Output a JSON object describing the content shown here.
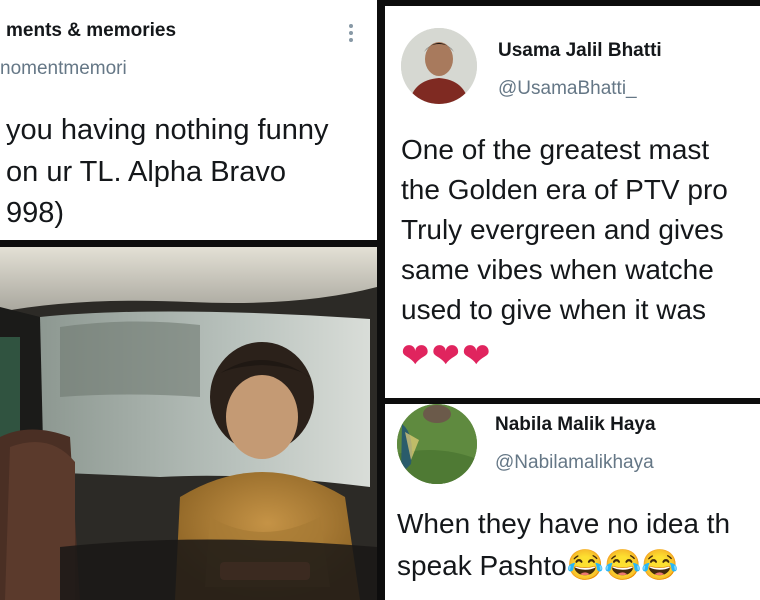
{
  "tweet_left": {
    "name": "ments & memories",
    "handle": "nomentmemori",
    "text_lines": [
      "you having nothing funny",
      "on ur TL. Alpha Bravo",
      "998)"
    ]
  },
  "tweet_right_top": {
    "name": "Usama Jalil Bhatti",
    "handle": "@UsamaBhatti_",
    "text_lines": [
      "One of the greatest mast",
      "the Golden era of PTV pro",
      "Truly evergreen and gives",
      "same vibes when watche",
      "used to give when it was"
    ],
    "hearts": "❤❤❤"
  },
  "tweet_right_bottom": {
    "name": "Nabila Malik Haya",
    "handle": "@Nabilamalikhaya",
    "text_lines": [
      "When they have no idea th",
      "speak Pashto"
    ],
    "emojis": "😂😂😂"
  },
  "colors": {
    "heart": "#e0245e",
    "handle": "#657786",
    "text": "#14171a"
  }
}
